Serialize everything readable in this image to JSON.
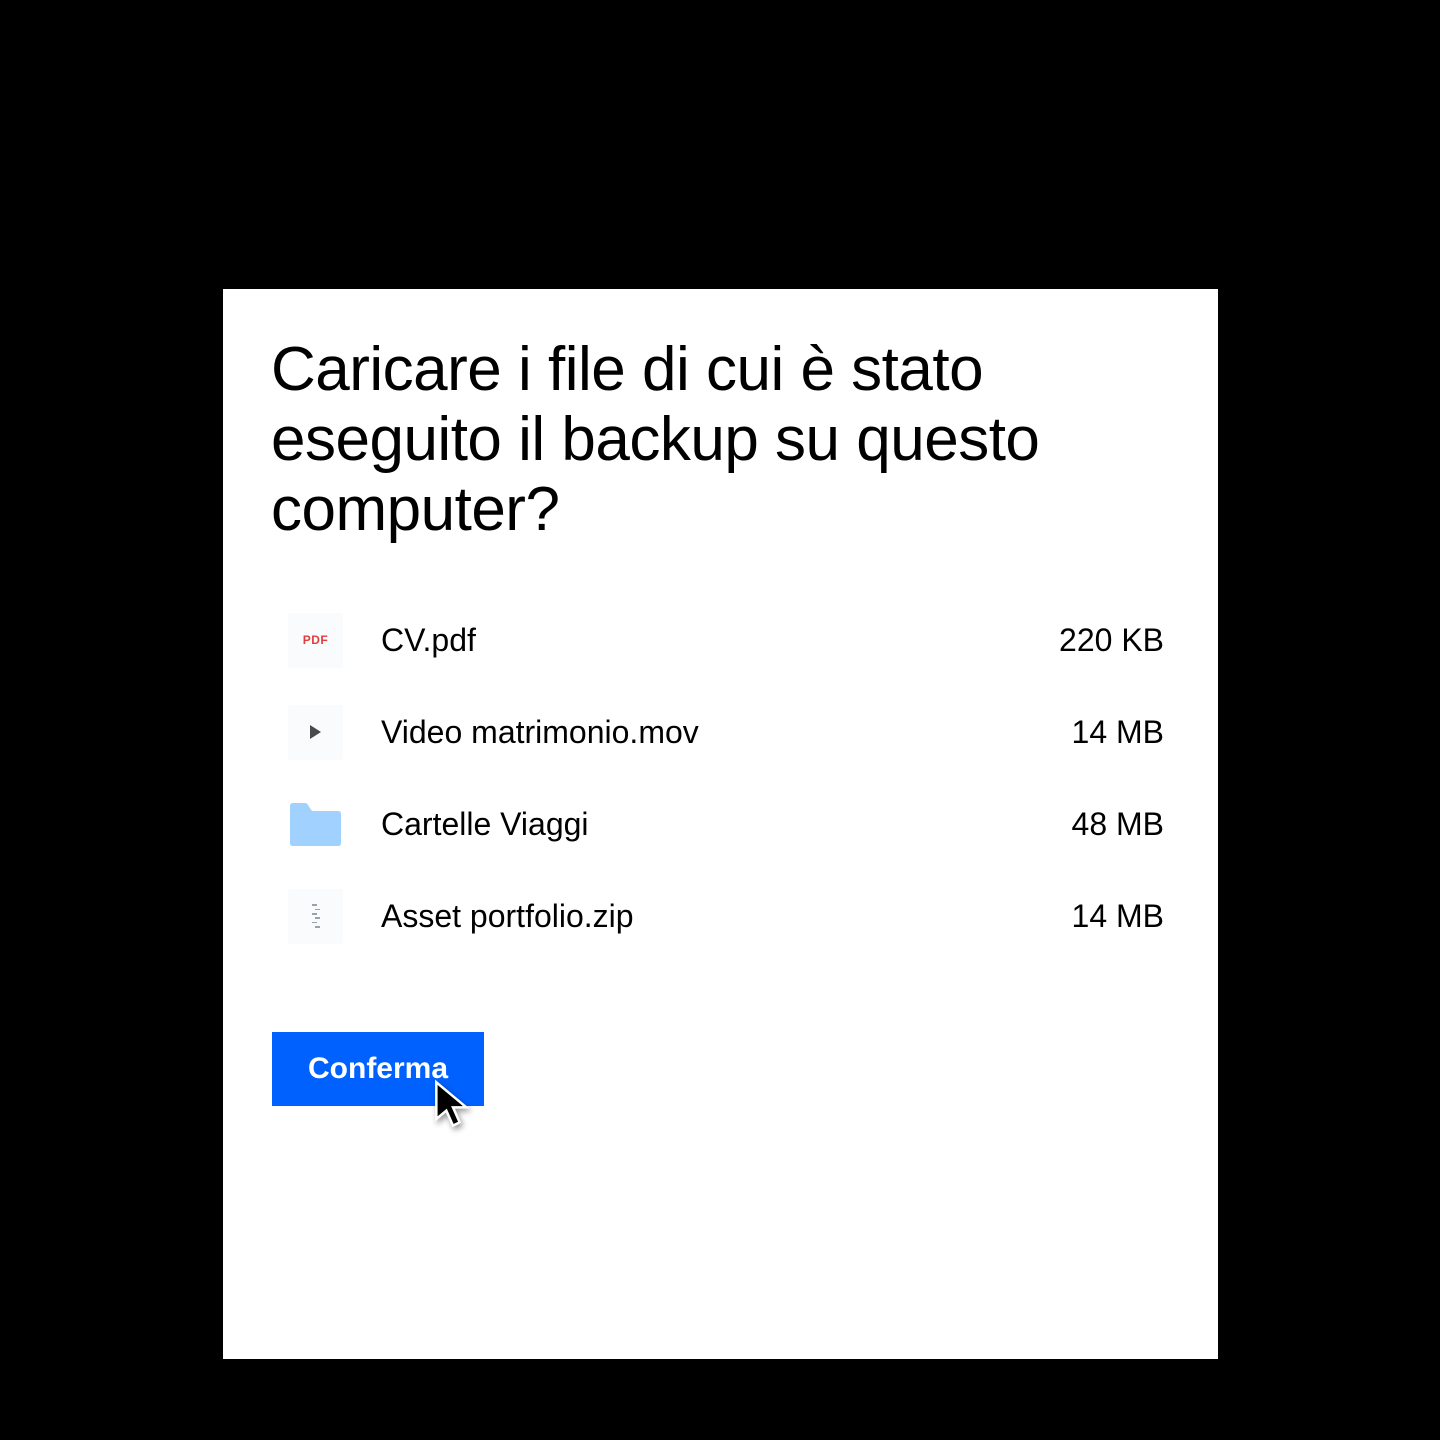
{
  "heading": "Caricare i file di cui è stato eseguito il backup su questo computer?",
  "files": [
    {
      "icon": "pdf",
      "name": "CV.pdf",
      "size": "220 KB"
    },
    {
      "icon": "video",
      "name": "Video matrimonio.mov",
      "size": "14 MB"
    },
    {
      "icon": "folder",
      "name": "Cartelle Viaggi",
      "size": "48 MB"
    },
    {
      "icon": "zip",
      "name": "Asset portfolio.zip",
      "size": "14 MB"
    }
  ],
  "confirm_label": "Conferma",
  "pdf_badge": "PDF",
  "colors": {
    "accent": "#0061ff",
    "folder_fill": "#a1d2ff",
    "pdf_text": "#e23d3d"
  }
}
